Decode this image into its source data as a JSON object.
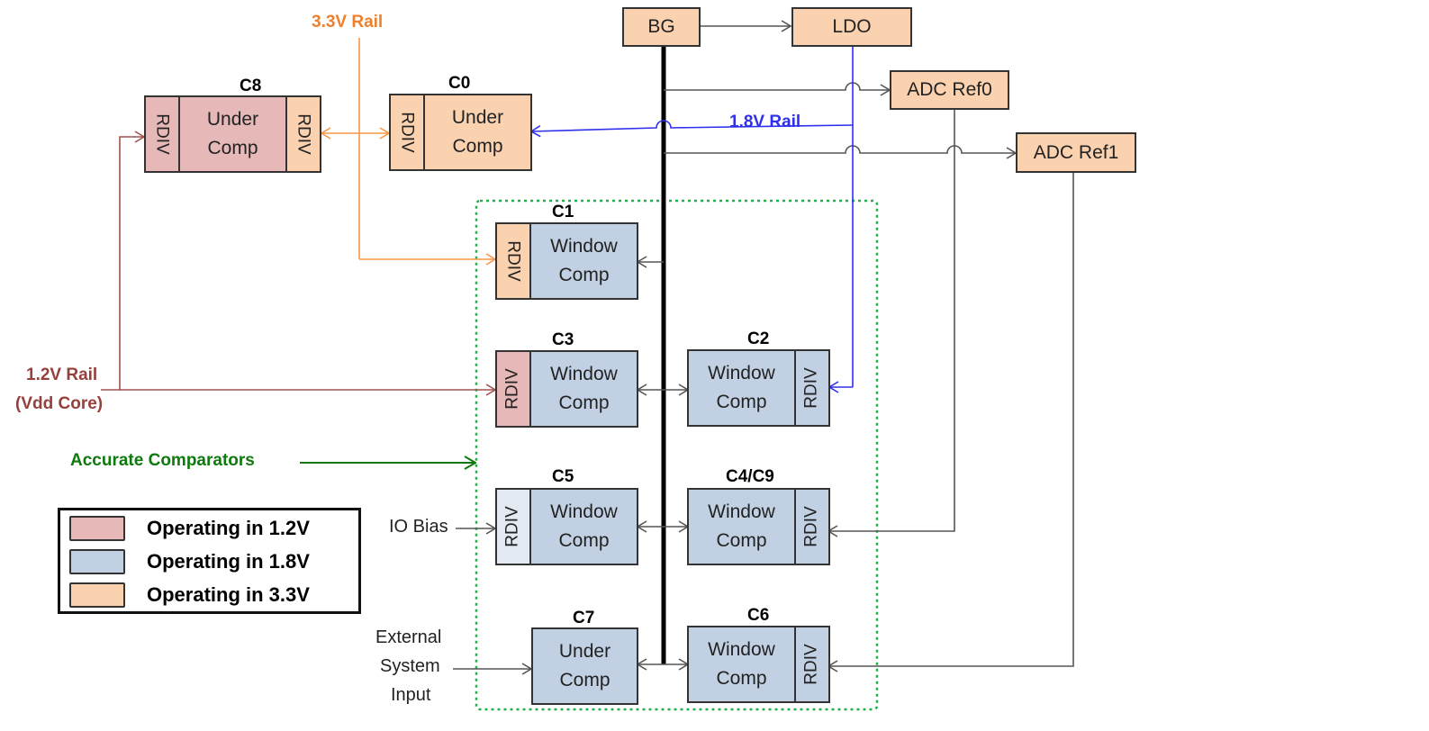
{
  "colors": {
    "v12": "#E6B9B8",
    "v18": "#C1D1E3",
    "v33": "#FAD2B0",
    "io": "#E2E9F1",
    "rail33": "#F79646",
    "rail18": "#2F2FEF",
    "rail12": "#A0524E",
    "accurate": "#0E7A0E"
  },
  "rails": {
    "r33": "3.3V Rail",
    "r18": "1.8V Rail",
    "r12_line1": "1.2V Rail",
    "r12_line2": "(Vdd Core)"
  },
  "sources": {
    "bg": "BG",
    "ldo": "LDO",
    "adc0": "ADC Ref0",
    "adc1": "ADC Ref1"
  },
  "blocks": {
    "rdiv": "RDIV",
    "c8": {
      "name": "C8",
      "l1": "Under",
      "l2": "Comp"
    },
    "c0": {
      "name": "C0",
      "l1": "Under",
      "l2": "Comp"
    },
    "c1": {
      "name": "C1",
      "l1": "Window",
      "l2": "Comp"
    },
    "c3": {
      "name": "C3",
      "l1": "Window",
      "l2": "Comp"
    },
    "c2": {
      "name": "C2",
      "l1": "Window",
      "l2": "Comp"
    },
    "c5": {
      "name": "C5",
      "l1": "Window",
      "l2": "Comp"
    },
    "c49": {
      "name": "C4/C9",
      "l1": "Window",
      "l2": "Comp"
    },
    "c7": {
      "name": "C7",
      "l1": "Under",
      "l2": "Comp"
    },
    "c6": {
      "name": "C6",
      "l1": "Window",
      "l2": "Comp"
    }
  },
  "inputs": {
    "io_bias": "IO Bias",
    "ext1": "External",
    "ext2": "System",
    "ext3": "Input"
  },
  "annotation": "Accurate Comparators",
  "legend": [
    {
      "label": "Operating in 1.2V",
      "color": "#E6B9B8"
    },
    {
      "label": "Operating in 1.8V",
      "color": "#C1D1E3"
    },
    {
      "label": "Operating in 3.3V",
      "color": "#FAD2B0"
    }
  ]
}
